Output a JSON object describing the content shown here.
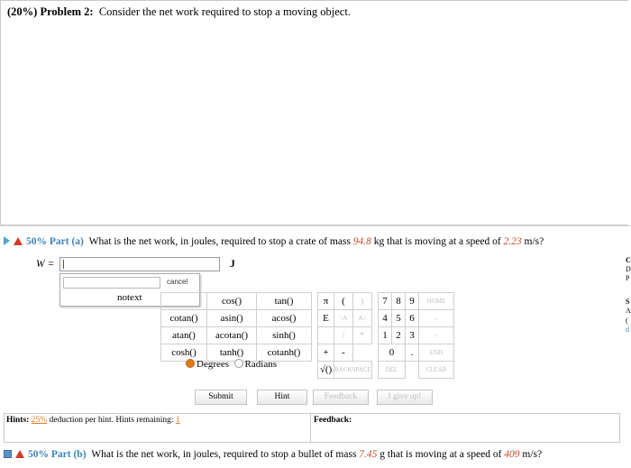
{
  "problem": {
    "prefix": "(20%) Problem 2:",
    "statement": "Consider the net work required to stop a moving object."
  },
  "part_a": {
    "weight": "50%",
    "label": "Part (a)",
    "question_before_mass": "What is the net work, in joules, required to stop a crate of mass",
    "mass": "94.8",
    "mass_unit_text": "kg that is moving at a speed of",
    "speed": "2.23",
    "speed_unit_text": "m/s?",
    "variable": "W",
    "equals": "=",
    "unit": "J",
    "answer_value": ""
  },
  "dropdown": {
    "cancel_label": "cancel",
    "notext_label": "notext"
  },
  "keypad": {
    "functions": [
      [
        "",
        "cos()",
        "tan()"
      ],
      [
        "cotan()",
        "asin()",
        "acos()"
      ],
      [
        "atan()",
        "acotan()",
        "sinh()"
      ],
      [
        "cosh()",
        "tanh()",
        "cotanh()"
      ]
    ],
    "symbols": [
      [
        "π",
        "("
      ],
      [
        "E",
        "↑A"
      ],
      [
        "",
        "/"
      ],
      [
        "+",
        "-"
      ],
      [
        "√()",
        ""
      ]
    ],
    "numbers": [
      [
        "7",
        "8",
        "9",
        "HOME"
      ],
      [
        "4",
        "5",
        "6",
        "←"
      ],
      [
        "1",
        "2",
        "3",
        "→"
      ],
      [
        "",
        "0",
        ".",
        "END"
      ],
      [
        "BACKSPACE",
        "",
        "DEL",
        "CLEAR"
      ]
    ],
    "extra_sym": [
      ")",
      "A↓",
      "*"
    ],
    "degrees_label": "Degrees",
    "radians_label": "Radians"
  },
  "buttons": {
    "submit": "Submit",
    "hint": "Hint",
    "feedback": "Feedback",
    "give_up": "I give up!"
  },
  "hints": {
    "label": "Hints:",
    "percent": "25%",
    "middle": "deduction per hint. Hints remaining:",
    "remaining": "1"
  },
  "feedback": {
    "label": "Feedback:"
  },
  "part_b": {
    "weight": "50%",
    "label": "Part (b)",
    "question_before_mass": "What is the net work, in joules, required to stop a bullet of mass",
    "mass": "7.45",
    "mass_unit_text": "g that is moving at a speed of",
    "speed": "409",
    "speed_unit_text": "m/s?"
  },
  "side_letters": [
    "C",
    "D",
    "P",
    "S",
    "A",
    "(",
    "d"
  ],
  "colors": {
    "accent_blue": "#3b82b8",
    "given_red": "#c44a2a",
    "hint_orange": "#e07a1a"
  }
}
